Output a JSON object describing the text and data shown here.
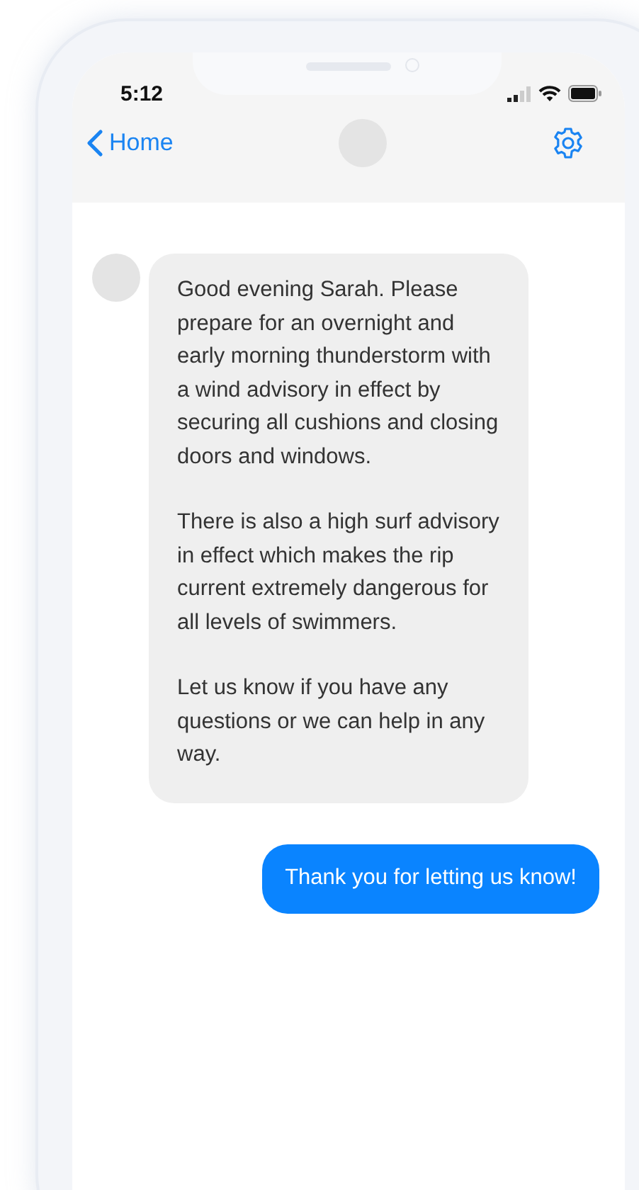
{
  "status_bar": {
    "time": "5:12"
  },
  "nav_bar": {
    "back_label": "Home"
  },
  "messages": [
    {
      "kind": "incoming",
      "paragraphs": [
        "Good evening Sarah. Please prepare for an overnight and early morning thunderstorm with a wind advisory in effect by securing all cushions and closing doors and windows.",
        "There is also a high surf advisory in effect which makes the rip current extremely dangerous for all levels of swimmers.",
        "Let us know if you have any questions or we can help in any way."
      ]
    },
    {
      "kind": "outgoing",
      "paragraphs": [
        "Thank you for letting us know!"
      ]
    }
  ]
}
